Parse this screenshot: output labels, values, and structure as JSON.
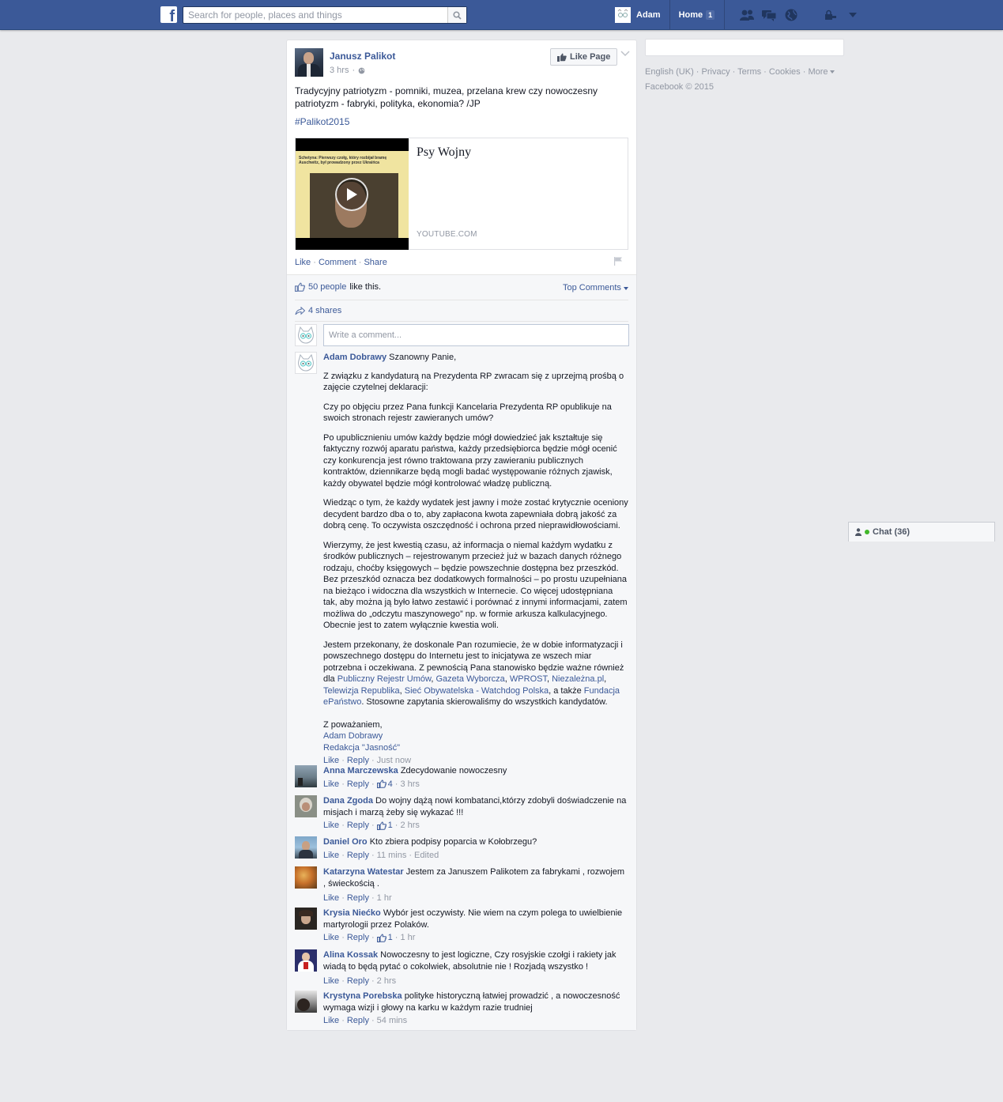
{
  "topbar": {
    "logo": "f",
    "search_placeholder": "Search for people, places and things",
    "profile_name": "Adam",
    "home_label": "Home",
    "home_count": "1",
    "icons": [
      "friend-requests-icon",
      "messages-icon",
      "notifications-icon",
      "privacy-icon",
      "account-menu-icon"
    ],
    "brand_color": "#3b5998"
  },
  "post": {
    "author": "Janusz Palikot",
    "time": "3 hrs",
    "like_page_label": "Like Page",
    "text": "Tradycyjny patriotyzm - pomniki, muzea, przelana krew czy nowoczesny patriotyzm - fabryki, polityka, ekonomia? /JP",
    "hashtag": "#Palikot2015",
    "link": {
      "title": "Psy Wojny",
      "source": "YOUTUBE.COM",
      "thumb_caption": "Schetyna: Pierwszy czołg, który rozbijał bramę Auschwitz, był prowadzony przez Ukraińca"
    },
    "actions": {
      "like": "Like",
      "comment": "Comment",
      "share": "Share"
    }
  },
  "ufi": {
    "likes_link": "50 people",
    "likes_suffix": "like this.",
    "top_comments": "Top Comments",
    "shares": "4 shares",
    "comment_placeholder": "Write a comment..."
  },
  "comments": [
    {
      "author": "Adam Dobrawy",
      "first_line": "Szanowny Panie,",
      "paragraphs": [
        "Z związku z kandydaturą na Prezydenta RP zwracam się z uprzejmą prośbą o zajęcie czytelnej deklaracji:",
        "Czy po objęciu przez Pana funkcji Kancelaria Prezydenta RP opublikuje na swoich stronach rejestr zawieranych umów?",
        "Po upublicznieniu umów każdy będzie mógł dowiedzieć jak kształtuje się faktyczny rozwój aparatu państwa, każdy przedsiębiorca będzie mógł ocenić czy konkurencja jest równo traktowana przy zawieraniu publicznych kontraktów, dziennikarze będą mogli badać występowanie różnych zjawisk, każdy obywatel będzie mógł kontrolować władzę publiczną.",
        "Wiedząc o tym, że każdy wydatek jest jawny i może zostać krytycznie oceniony decydent bardzo dba o to, aby zapłacona kwota zapewniała dobrą jakość za dobrą cenę. To oczywista oszczędność i ochrona przed nieprawidłowościami.",
        "Wierzymy, że jest kwestią czasu, aż informacja o niemal każdym wydatku z środków publicznych – rejestrowanym przecież już w bazach danych różnego rodzaju, choćby księgowych – będzie powszechnie dostępna bez przeszkód. Bez przeszkód oznacza bez dodatkowych formalności – po prostu uzupełniana na bieżąco i widoczna dla wszystkich w Internecie. Co więcej udostępniana tak, aby można ją było łatwo zestawić i porównać z innymi informacjami, zatem możliwa do „odczytu maszynowego” np. w formie arkusza kalkulacyjnego. Obecnie jest to zatem wyłącznie kwestia woli."
      ],
      "p6_text_a": "Jestem przekonany, że doskonale Pan rozumiecie, że w dobie informatyzacji i powszechnego dostępu do Internetu jest to inicjatywa ze wszech miar potrzebna i oczekiwana. Z pewnością Pana stanowisko będzie ważne również dla ",
      "p6_links": [
        "Publiczny Rejestr Umów",
        "Gazeta Wyborcza",
        "WPROST",
        "Niezależna.pl",
        "Telewizja Republika",
        "Sieć Obywatelska - Watchdog Polska",
        "Fundacja ePaństwo"
      ],
      "p6_text_b": ", a także ",
      "p6_text_c": ". Stosowne zapytania skierowaliśmy do wszystkich kandydatów.",
      "closing": "Z poważaniem,",
      "sign_name": "Adam Dobrawy",
      "sign_org": "Redakcja \"Jasność\"",
      "like": "Like",
      "reply": "Reply",
      "time": "Just now"
    },
    {
      "author": "Anna Marczewska",
      "text": "Zdecydowanie nowoczesny",
      "like": "Like",
      "reply": "Reply",
      "likes": "4",
      "time": "3 hrs"
    },
    {
      "author": "Dana Zgoda",
      "text": "Do wojny dążą nowi kombatanci,którzy zdobyli doświadczenie na misjach i marzą żeby się wykazać !!!",
      "like": "Like",
      "reply": "Reply",
      "likes": "1",
      "time": "2 hrs"
    },
    {
      "author": "Daniel Oro",
      "text": "Kto zbiera podpisy poparcia w Kołobrzegu?",
      "like": "Like",
      "reply": "Reply",
      "time": "11 mins",
      "edited": "Edited"
    },
    {
      "author": "Katarzyna Watestar",
      "text": "Jestem za Januszem Palikotem za fabrykami , rozwojem , świeckością .",
      "like": "Like",
      "reply": "Reply",
      "time": "1 hr"
    },
    {
      "author": "Krysia Niećko",
      "text": "Wybór jest oczywisty. Nie wiem na czym polega to uwielbienie martyrologii przez Polaków.",
      "like": "Like",
      "reply": "Reply",
      "likes": "1",
      "time": "1 hr"
    },
    {
      "author": "Alina Kossak",
      "text": "Nowoczesny to jest logiczne, Czy rosyjskie czołgi i rakiety jak wiadą to będą pytać o cokolwiek, absolutnie nie ! Rozjadą wszystko !",
      "like": "Like",
      "reply": "Reply",
      "time": "2 hrs"
    },
    {
      "author": "Krystyna Porebska",
      "text": "polityke historyczną łatwiej prowadzić , a nowoczesność wymaga wizji i głowy na karku w każdym razie trudniej",
      "like": "Like",
      "reply": "Reply",
      "time": "54 mins"
    }
  ],
  "sidebar": {
    "footer": [
      "English (UK)",
      "Privacy",
      "Terms",
      "Cookies",
      "More"
    ],
    "copyright": "Facebook © 2015"
  },
  "chat": {
    "label": "Chat (36)"
  }
}
